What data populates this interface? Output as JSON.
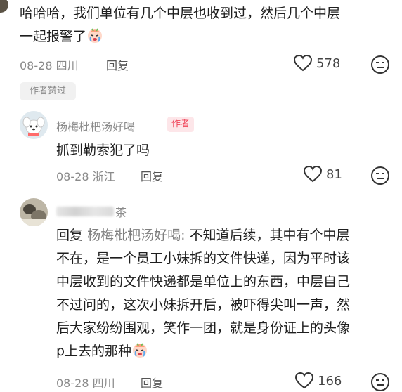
{
  "comment1": {
    "text_line1": "哈哈哈，我们单位有几个中层也收到过，然后几个中层",
    "text_line2": "一起报警了",
    "emoji": "crying-face",
    "date": "08-28",
    "location": "四川",
    "reply_label": "回复",
    "likes": "578",
    "author_liked": "作者赞过"
  },
  "comment2": {
    "username": "杨梅枇杷汤好喝",
    "author_badge": "作者",
    "text": "抓到勒索犯了吗",
    "date": "08-28",
    "location": "浙江",
    "reply_label": "回复",
    "likes": "81"
  },
  "comment3": {
    "username_visible": "茶",
    "reply_prefix": "回复",
    "reply_target": "杨梅枇杷汤好喝:",
    "lines": [
      " 不知道后续，其中有个中层",
      "不在，是一个员工小妹拆的文件快递，因为平时该",
      "中层收到的文件快递都是单位上的东西，中层自己",
      "不过问的，这次小妹拆开后，被吓得尖叫一声，然",
      "后大家纷纷围观，笑作一团，就是身份证上的头像",
      "p上去的那种"
    ],
    "emoji": "crying-face",
    "date": "08-28",
    "location": "四川",
    "reply_label": "回复",
    "likes": "166"
  },
  "colors": {
    "author_badge_text": "#f0455a",
    "author_badge_bg": "#fde6e9",
    "meta_gray": "#8a8a8a"
  }
}
